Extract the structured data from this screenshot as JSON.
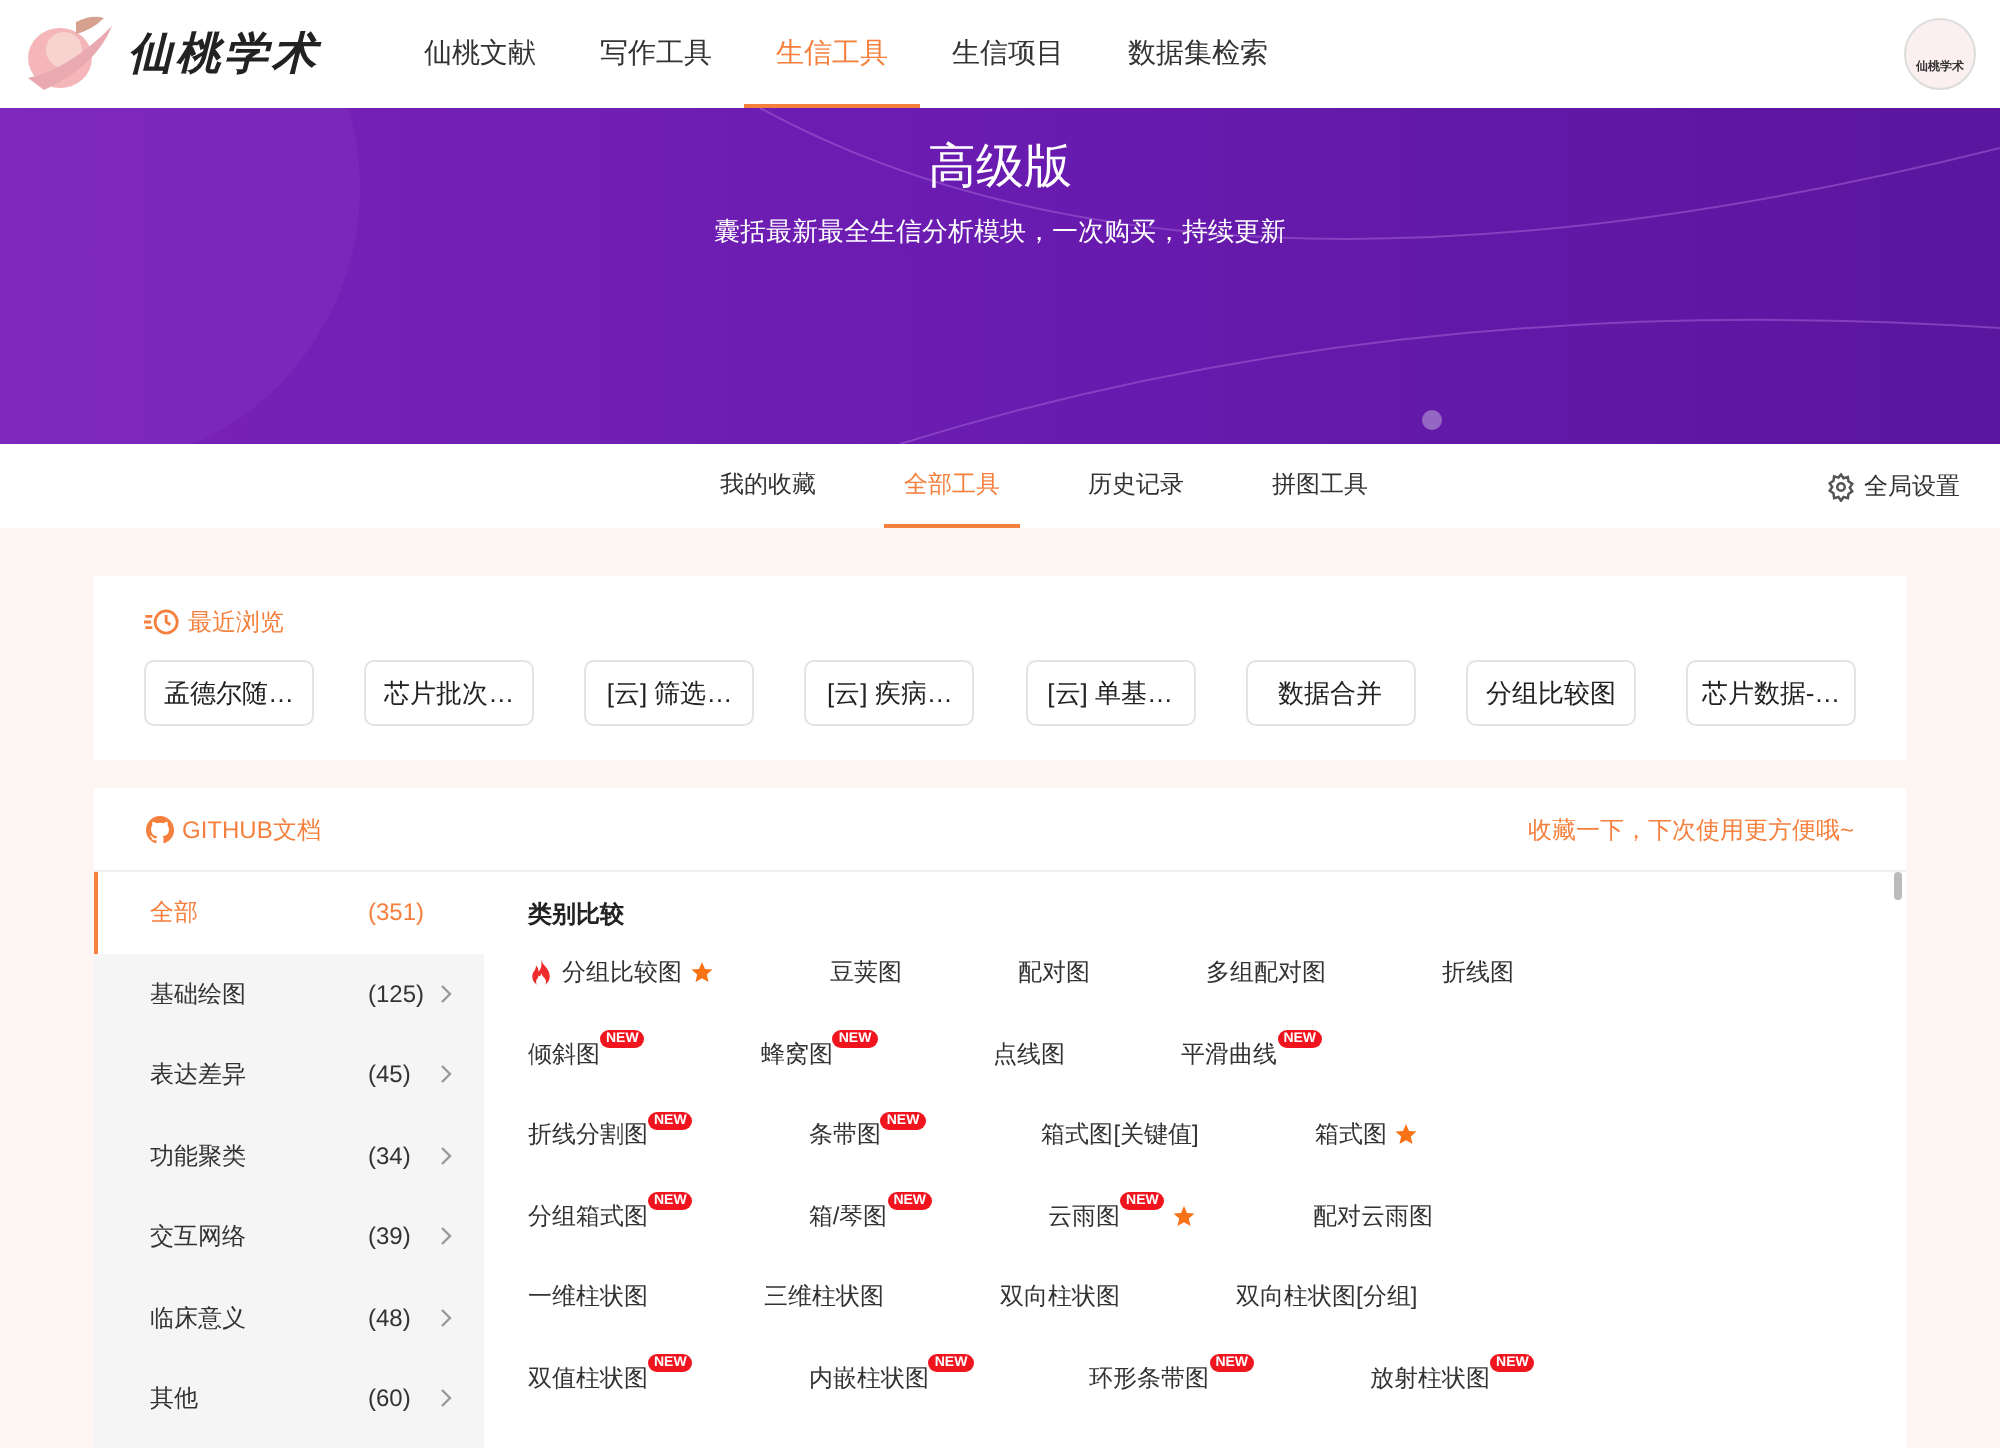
{
  "header": {
    "logo_text": "仙桃学术",
    "nav": [
      {
        "label": "仙桃文献",
        "selected": false
      },
      {
        "label": "写作工具",
        "selected": false
      },
      {
        "label": "生信工具",
        "selected": true
      },
      {
        "label": "生信项目",
        "selected": false
      },
      {
        "label": "数据集检索",
        "selected": false
      }
    ],
    "avatar_text": "仙桃学术"
  },
  "banner": {
    "title": "高级版",
    "subtitle": "囊括最新最全生信分析模块，一次购买，持续更新"
  },
  "tabs": [
    {
      "label": "我的收藏",
      "selected": false
    },
    {
      "label": "全部工具",
      "selected": true
    },
    {
      "label": "历史记录",
      "selected": false
    },
    {
      "label": "拼图工具",
      "selected": false
    }
  ],
  "settings_label": "全局设置",
  "recent": {
    "title": "最近浏览",
    "items": [
      "孟德尔随…",
      "芯片批次…",
      "[云] 筛选…",
      "[云] 疾病…",
      "[云] 单基…",
      "数据合并",
      "分组比较图",
      "芯片数据-…"
    ]
  },
  "tools": {
    "github_label": "GITHUB文档",
    "hint": "收藏一下，下次使用更方便哦~",
    "categories": [
      {
        "label": "全部",
        "count": "(351)",
        "selected": true,
        "chevron": false
      },
      {
        "label": "基础绘图",
        "count": "(125)",
        "selected": false,
        "chevron": true
      },
      {
        "label": "表达差异",
        "count": "(45)",
        "selected": false,
        "chevron": true
      },
      {
        "label": "功能聚类",
        "count": "(34)",
        "selected": false,
        "chevron": true
      },
      {
        "label": "交互网络",
        "count": "(39)",
        "selected": false,
        "chevron": true
      },
      {
        "label": "临床意义",
        "count": "(48)",
        "selected": false,
        "chevron": true
      },
      {
        "label": "其他",
        "count": "(60)",
        "selected": false,
        "chevron": true
      }
    ],
    "section_title": "类别比较",
    "rows": [
      [
        {
          "name": "分组比较图",
          "hot": true,
          "starred": true
        },
        {
          "name": "豆荚图",
          "hot": false,
          "starred": false
        },
        {
          "name": "配对图",
          "hot": false,
          "starred": false
        },
        {
          "name": "多组配对图",
          "hot": false,
          "starred": false
        },
        {
          "name": "折线图",
          "hot": false,
          "starred": false
        }
      ],
      [
        {
          "name": "倾斜图",
          "hot": false,
          "badge": "NEW",
          "starred": false
        },
        {
          "name": "蜂窝图",
          "hot": false,
          "badge": "NEW",
          "starred": false
        },
        {
          "name": "点线图",
          "hot": false,
          "starred": false
        },
        {
          "name": "平滑曲线",
          "hot": false,
          "badge": "NEW",
          "starred": false
        }
      ],
      [
        {
          "name": "折线分割图",
          "hot": false,
          "badge": "NEW",
          "starred": false
        },
        {
          "name": "条带图",
          "hot": false,
          "badge": "NEW",
          "starred": false
        },
        {
          "name": "箱式图[关键值]",
          "hot": false,
          "starred": false
        },
        {
          "name": "箱式图",
          "hot": false,
          "starred": true
        }
      ],
      [
        {
          "name": "分组箱式图",
          "hot": false,
          "badge": "NEW",
          "starred": false
        },
        {
          "name": "箱/琴图",
          "hot": false,
          "badge": "NEW",
          "starred": false
        },
        {
          "name": "云雨图",
          "hot": false,
          "badge": "NEW",
          "starred": true
        },
        {
          "name": "配对云雨图",
          "hot": false,
          "starred": false
        }
      ],
      [
        {
          "name": "一维柱状图",
          "hot": false,
          "starred": false
        },
        {
          "name": "三维柱状图",
          "hot": false,
          "starred": false
        },
        {
          "name": "双向柱状图",
          "hot": false,
          "starred": false
        },
        {
          "name": "双向柱状图[分组]",
          "hot": false,
          "starred": false
        }
      ],
      [
        {
          "name": "双值柱状图",
          "hot": false,
          "badge": "NEW",
          "starred": false
        },
        {
          "name": "内嵌柱状图",
          "hot": false,
          "badge": "NEW",
          "starred": false
        },
        {
          "name": "环形条带图",
          "hot": false,
          "badge": "NEW",
          "starred": false
        },
        {
          "name": "放射柱状图",
          "hot": false,
          "badge": "NEW",
          "starred": false
        }
      ]
    ]
  }
}
